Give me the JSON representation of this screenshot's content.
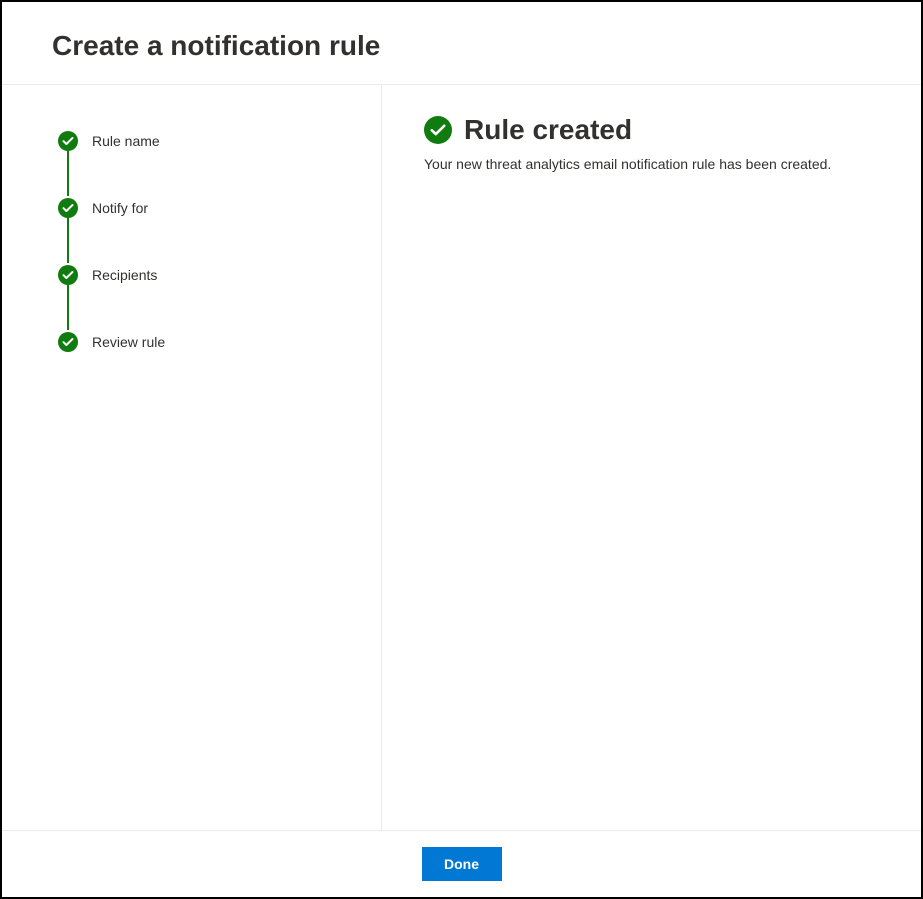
{
  "header": {
    "title": "Create a notification rule"
  },
  "sidebar": {
    "steps": [
      {
        "label": "Rule name",
        "status": "completed"
      },
      {
        "label": "Notify for",
        "status": "completed"
      },
      {
        "label": "Recipients",
        "status": "completed"
      },
      {
        "label": "Review rule",
        "status": "completed"
      }
    ]
  },
  "main": {
    "success_title": "Rule created",
    "success_text": "Your new threat analytics email notification rule has been created."
  },
  "footer": {
    "done_label": "Done"
  },
  "colors": {
    "success_green": "#107c10",
    "primary_blue": "#0078d4"
  }
}
